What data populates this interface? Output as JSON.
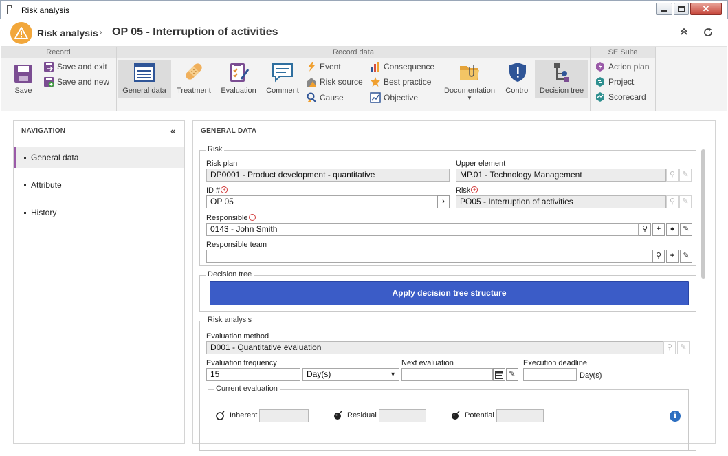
{
  "window": {
    "title": "Risk analysis"
  },
  "header": {
    "breadcrumb_root": "Risk analysis",
    "separator": "›",
    "title": "OP 05 - Interruption of activities"
  },
  "ribbon": {
    "groups": {
      "record": "Record",
      "record_data": "Record data",
      "se_suite": "SE Suite"
    },
    "record": {
      "save": "Save",
      "save_and_exit": "Save and exit",
      "save_and_new": "Save and new"
    },
    "record_data": {
      "general_data": "General data",
      "treatment": "Treatment",
      "evaluation": "Evaluation",
      "comment": "Comment",
      "event": "Event",
      "risk_source": "Risk source",
      "cause": "Cause",
      "consequence": "Consequence",
      "best_practice": "Best practice",
      "objective": "Objective",
      "documentation": "Documentation",
      "control": "Control",
      "decision_tree": "Decision tree"
    },
    "se_suite": {
      "action_plan": "Action plan",
      "project": "Project",
      "scorecard": "Scorecard"
    }
  },
  "navigation": {
    "title": "NAVIGATION",
    "collapse": "«",
    "items": [
      "General data",
      "Attribute",
      "History"
    ]
  },
  "main": {
    "title": "GENERAL DATA",
    "risk_section": {
      "legend": "Risk",
      "risk_plan_label": "Risk plan",
      "risk_plan_value": "DP0001 - Product development - quantitative",
      "upper_element_label": "Upper element",
      "upper_element_value": "MP.01 - Technology Management",
      "id_label": "ID #",
      "id_value": "OP 05",
      "risk_label": "Risk",
      "risk_value": "PO05 - Interruption of activities",
      "responsible_label": "Responsible",
      "responsible_value": "0143 - John Smith",
      "responsible_team_label": "Responsible team",
      "responsible_team_value": ""
    },
    "decision_tree_section": {
      "legend": "Decision tree",
      "apply_button": "Apply decision tree structure"
    },
    "risk_analysis_section": {
      "legend": "Risk analysis",
      "evaluation_method_label": "Evaluation method",
      "evaluation_method_value": "D001 - Quantitative evaluation",
      "evaluation_frequency_label": "Evaluation frequency",
      "evaluation_frequency_value": "15",
      "frequency_unit": "Day(s)",
      "next_evaluation_label": "Next evaluation",
      "next_evaluation_value": "",
      "execution_deadline_label": "Execution deadline",
      "execution_deadline_value": "",
      "deadline_unit": "Day(s)",
      "current_evaluation_legend": "Current evaluation",
      "inherent_label": "Inherent",
      "residual_label": "Residual",
      "potential_label": "Potential"
    }
  },
  "colors": {
    "accent_purple": "#9a5aa8",
    "apply_button_blue": "#3b5cc7",
    "warning_orange": "#f2a73b"
  }
}
